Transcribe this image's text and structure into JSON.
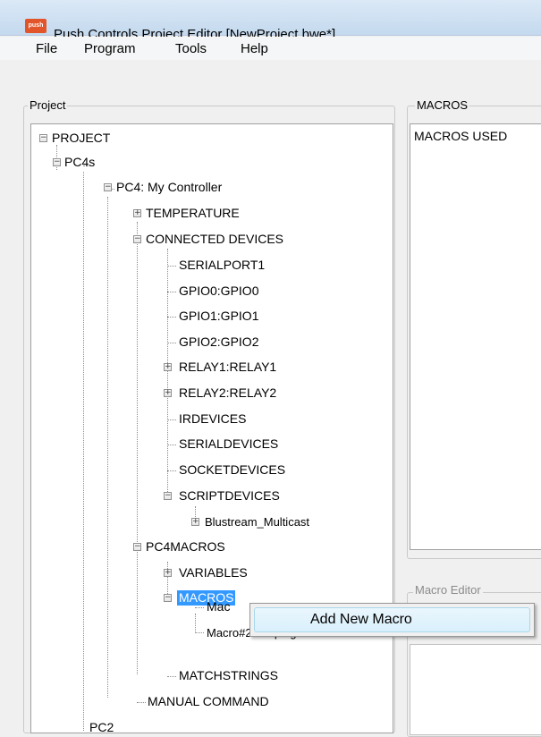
{
  "window": {
    "title": "Push Controls Project Editor [NewProject.bwe*]",
    "icon_text": "push"
  },
  "menu": {
    "file": "File",
    "program": "Program",
    "tools": "Tools",
    "help": "Help"
  },
  "project_panel": {
    "label": "Project",
    "tree": {
      "project": "PROJECT",
      "pc4s": "PC4s",
      "pc4": "PC4: My Controller",
      "temperature": "TEMPERATURE",
      "connected_devices": "CONNECTED DEVICES",
      "serialport1": "SERIALPORT1",
      "gpio0": "GPIO0:GPIO0",
      "gpio1": "GPIO1:GPIO1",
      "gpio2": "GPIO2:GPIO2",
      "relay1": "RELAY1:RELAY1",
      "relay2": "RELAY2:RELAY2",
      "irdevices": "IRDEVICES",
      "serialdevices": "SERIALDEVICES",
      "socketdevices": "SOCKETDEVICES",
      "scriptdevices": "SCRIPTDEVICES",
      "blustream": "Blustream_Multicast",
      "pc4macros": "PC4MACROS",
      "variables": "VARIABLES",
      "macros": "MACROS",
      "macro1": "Mac",
      "macro2": "Macro#2:Looping Ma",
      "matchstrings": "MATCHSTRINGS",
      "manual_command": "MANUAL COMMAND",
      "last_partial": "PC2"
    }
  },
  "macros_panel": {
    "label": "MACROS",
    "content": "MACROS USED"
  },
  "macro_editor": {
    "label": "Macro Editor"
  },
  "context_menu": {
    "add_new_macro": "Add New Macro"
  }
}
